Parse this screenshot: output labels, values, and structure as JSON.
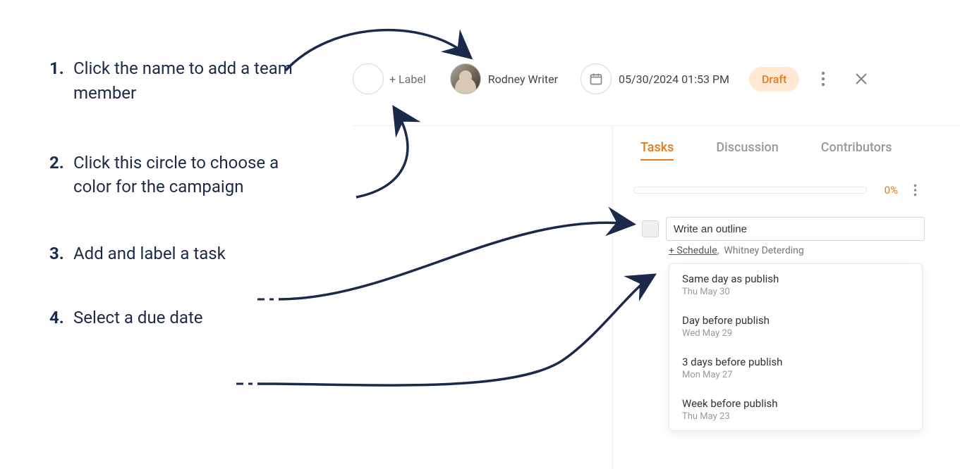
{
  "annotations": {
    "step1": {
      "num": "1.",
      "text": "Click the name to add a team member"
    },
    "step2": {
      "num": "2.",
      "text": "Click this circle to choose a color for the campaign"
    },
    "step3": {
      "num": "3.",
      "text": "Add and label a task"
    },
    "step4": {
      "num": "4.",
      "text": "Select a due date"
    }
  },
  "toolbar": {
    "label_button": "+ Label",
    "owner_name": "Rodney Writer",
    "date": "05/30/2024 01:53 PM",
    "status_badge": "Draft"
  },
  "tabs": {
    "tasks": "Tasks",
    "discussion": "Discussion",
    "contributors": "Contributors"
  },
  "progress_pct": "0%",
  "task": {
    "title": "Write an outline",
    "schedule_label": "+ Schedule",
    "assignee": "Whitney Deterding"
  },
  "due_options": [
    {
      "title": "Same day as publish",
      "date": "Thu May 30"
    },
    {
      "title": "Day before publish",
      "date": "Wed May 29"
    },
    {
      "title": "3 days before publish",
      "date": "Mon May 27"
    },
    {
      "title": "Week before publish",
      "date": "Thu May 23"
    }
  ]
}
